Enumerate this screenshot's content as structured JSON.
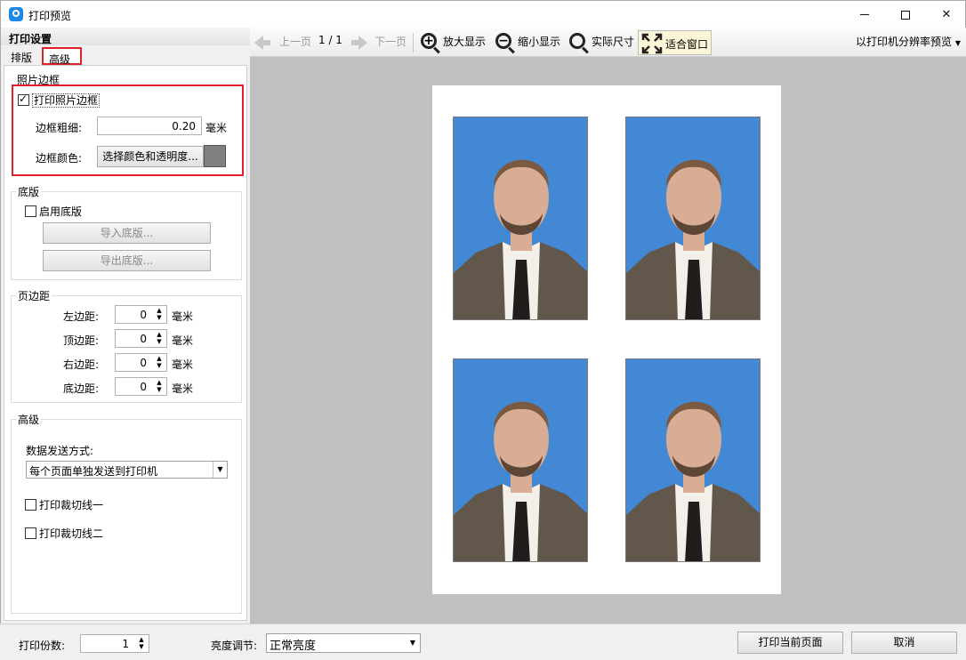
{
  "window": {
    "title": "打印预览",
    "min_icon": "minimize-icon",
    "max_icon": "maximize-icon",
    "close_icon": "close-icon",
    "app_icon": "app-logo-icon"
  },
  "left": {
    "header": "打印设置",
    "tabs": [
      {
        "label": "排版"
      },
      {
        "label": "高级"
      }
    ],
    "photo_border": {
      "title": "照片边框",
      "print_border_label": "打印照片边框",
      "print_border_checked": true,
      "thickness_label": "边框粗细:",
      "thickness_value": "0.20",
      "thickness_unit": "毫米",
      "color_label": "边框颜色:",
      "color_button": "选择颜色和透明度...",
      "color_value": "#808080"
    },
    "underlay": {
      "title": "底版",
      "enable_label": "启用底版",
      "enable_checked": false,
      "import_button": "导入底版...",
      "export_button": "导出底版..."
    },
    "margins": {
      "title": "页边距",
      "rows": [
        {
          "label": "左边距:",
          "value": "0",
          "unit": "毫米"
        },
        {
          "label": "顶边距:",
          "value": "0",
          "unit": "毫米"
        },
        {
          "label": "右边距:",
          "value": "0",
          "unit": "毫米"
        },
        {
          "label": "底边距:",
          "value": "0",
          "unit": "毫米"
        }
      ]
    },
    "advanced": {
      "title": "高级",
      "send_mode_label": "数据发送方式:",
      "send_mode_value": "每个页面单独发送到打印机",
      "cut_line_1": "打印裁切线一",
      "cut_line_2": "打印裁切线二"
    }
  },
  "toolbar": {
    "prev_page": "上一页",
    "page_indicator": "1 / 1",
    "next_page": "下一页",
    "zoom_in": "放大显示",
    "zoom_out": "缩小显示",
    "actual_size": "实际尺寸",
    "fit_window": "适合窗口",
    "resolution_preview": "以打印机分辨率预览"
  },
  "preview": {
    "photo_count": 4,
    "background_color": "#4388d4"
  },
  "bottom": {
    "copies_label": "打印份数:",
    "copies_value": "1",
    "brightness_label": "亮度调节:",
    "brightness_value": "正常亮度",
    "print_button": "打印当前页面",
    "cancel_button": "取消"
  }
}
